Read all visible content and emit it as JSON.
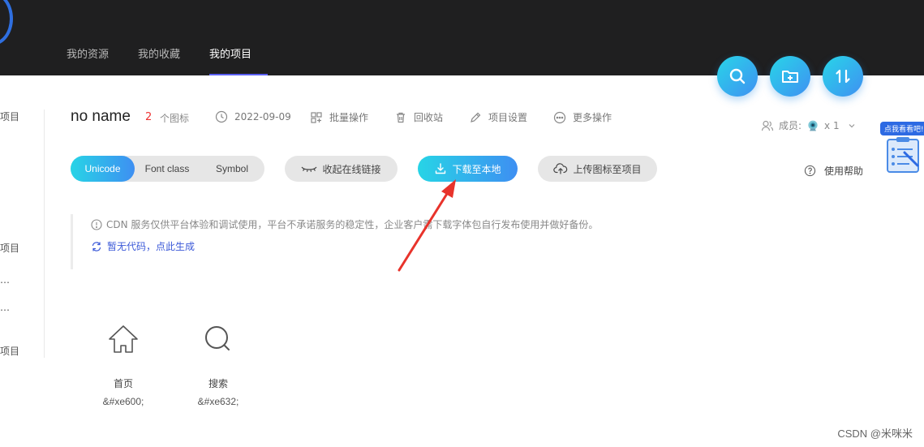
{
  "nav": {
    "tabs": [
      {
        "label": "我的资源"
      },
      {
        "label": "我的收藏"
      },
      {
        "label": "我的项目"
      }
    ],
    "active_tab": "我的项目",
    "accent_color": "#5a5ff2"
  },
  "fab": {
    "search_icon": "search-icon",
    "new_folder_icon": "folder-plus-icon",
    "sort_icon": "sort-arrows-icon"
  },
  "sidebar": {
    "items": [
      "项目",
      "项目",
      "…",
      "…",
      "项目"
    ]
  },
  "project": {
    "name": "no name",
    "icon_count": "2",
    "icon_count_unit": "个图标",
    "date": "2022-09-09",
    "batch_label": "批量操作",
    "recycle_label": "回收站",
    "settings_label": "项目设置",
    "more_label": "更多操作",
    "members_label": "成员:",
    "members_count": "x 1"
  },
  "toolbar": {
    "modes": [
      "Unicode",
      "Font class",
      "Symbol"
    ],
    "active_mode": "Unicode",
    "collapse_link_label": "收起在线链接",
    "download_label": "下载至本地",
    "upload_label": "上传图标至项目",
    "help_label": "使用帮助",
    "gradient_start": "#27d4e6",
    "gradient_end": "#3e8ff2"
  },
  "notice": {
    "text": "CDN 服务仅供平台体验和调试使用，平台不承诺服务的稳定性，企业客户需下载字体包自行发布使用并做好备份。",
    "link": "暂无代码，点此生成"
  },
  "icons": [
    {
      "name": "首页",
      "code": "&#xe600;",
      "glyph": "home-icon"
    },
    {
      "name": "搜索",
      "code": "&#xe632;",
      "glyph": "search-icon"
    }
  ],
  "promo": {
    "tag": "点我看看吧!"
  },
  "watermark": "CSDN @米咪米"
}
